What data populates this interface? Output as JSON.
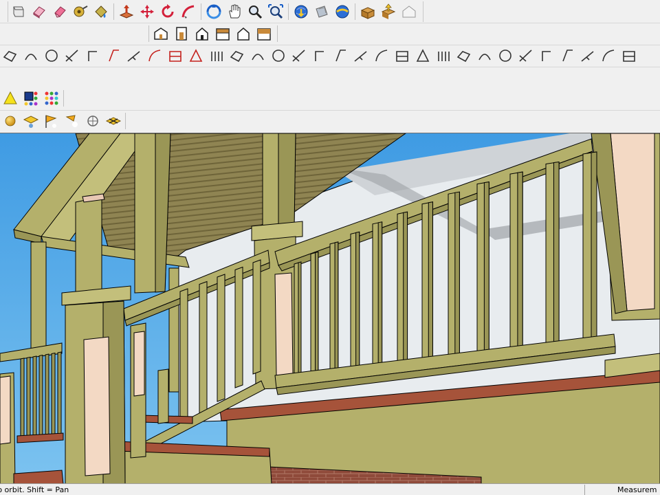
{
  "colors": {
    "trim_green": "#b4b06b",
    "trim_shadow": "#9a9656",
    "trim_dark": "#7e7b46",
    "panel_pink": "#f3d9c4",
    "sky_blue": "#5aaee8",
    "wall_white": "#e8ecef",
    "wall_shadow": "#c9cdd1",
    "ceiling": "#8b7f50",
    "ceiling_dark": "#6a6039",
    "deck_red": "#a6533a",
    "brick": "#8f4a3a",
    "outline": "#000000"
  },
  "toolbars": {
    "row1": [
      {
        "name": "scroll-icon"
      },
      {
        "name": "eraser-3d-icon"
      },
      {
        "name": "eraser-icon"
      },
      {
        "name": "tape-measure-icon"
      },
      {
        "name": "paint-bucket-icon"
      },
      {
        "name": "push-pull-icon"
      },
      {
        "name": "move-icon"
      },
      {
        "name": "rotate-icon"
      },
      {
        "name": "follow-me-icon"
      },
      {
        "name": "orbit-icon"
      },
      {
        "name": "pan-icon"
      },
      {
        "name": "zoom-icon"
      },
      {
        "name": "zoom-extents-icon"
      },
      {
        "name": "get-models-icon"
      },
      {
        "name": "share-model-icon"
      },
      {
        "name": "share-component-icon"
      },
      {
        "name": "import-icon"
      },
      {
        "name": "export-icon"
      },
      {
        "name": "warehouse-icon"
      }
    ],
    "row2": [
      {
        "name": "view-iso-icon"
      },
      {
        "name": "view-front-door-icon"
      },
      {
        "name": "view-front-icon"
      },
      {
        "name": "view-right-icon"
      },
      {
        "name": "view-back-icon"
      },
      {
        "name": "view-top-icon"
      }
    ],
    "row3_count": 31,
    "row4": [
      {
        "name": "shadows-icon"
      },
      {
        "name": "styles-icon"
      },
      {
        "name": "color-palette-icon"
      }
    ],
    "row5": [
      {
        "name": "sphere-icon"
      },
      {
        "name": "section-plane-icon"
      },
      {
        "name": "section-flag-icon"
      },
      {
        "name": "section-display-icon"
      },
      {
        "name": "sun-icon"
      },
      {
        "name": "dimension-plane-icon"
      }
    ]
  },
  "status": {
    "hint": "to orbit.  Shift = Pan",
    "measure_label": "Measurem"
  }
}
